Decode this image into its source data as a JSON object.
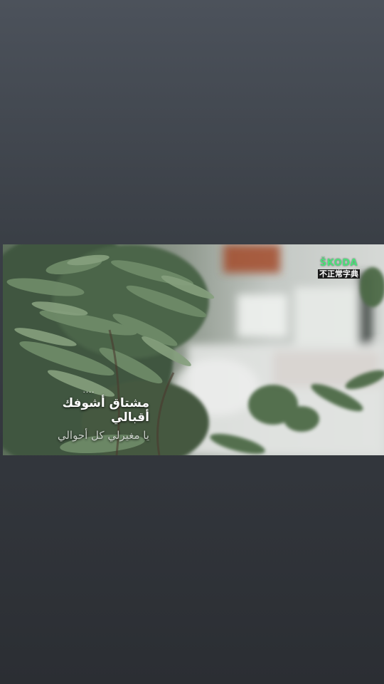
{
  "video": {
    "logo": {
      "brand": "ŠKODA",
      "subtitle": "不正常字典"
    },
    "lyrics": {
      "dots": "....",
      "line1": "مشتاق أشوفك أقبالي",
      "line2": "يا مغيرلي كل أحوالي"
    }
  },
  "colors": {
    "background_top": "#4c525b",
    "background_bottom": "#2b2e33",
    "logo_green": "#4be07a",
    "leaf_green": "#4e6a4c"
  }
}
